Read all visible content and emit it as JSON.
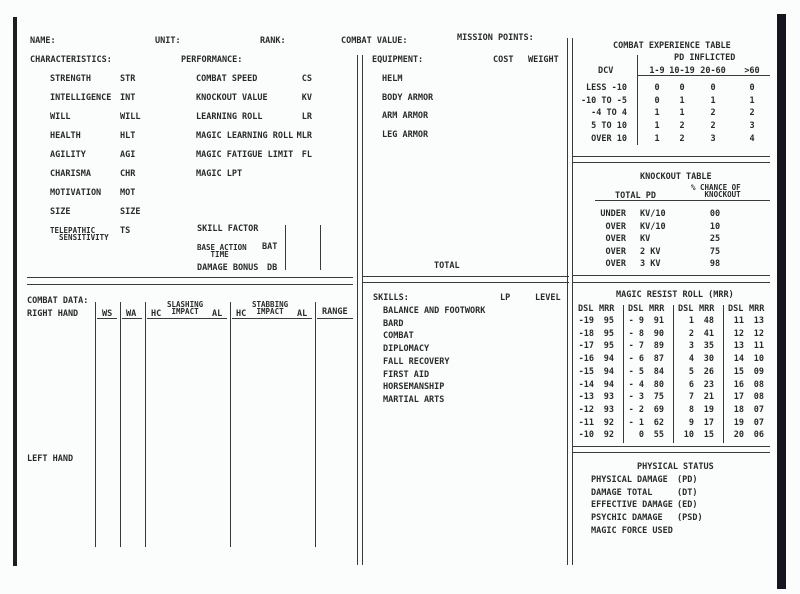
{
  "header": {
    "name_label": "NAME:",
    "unit_label": "UNIT:",
    "rank_label": "RANK:",
    "combat_value_label": "COMBAT VALUE:",
    "mission_points_label": "MISSION POINTS:"
  },
  "characteristics": {
    "title": "CHARACTERISTICS:",
    "items": [
      {
        "label": "STRENGTH",
        "abbr": "STR"
      },
      {
        "label": "INTELLIGENCE",
        "abbr": "INT"
      },
      {
        "label": "WILL",
        "abbr": "WILL"
      },
      {
        "label": "HEALTH",
        "abbr": "HLT"
      },
      {
        "label": "AGILITY",
        "abbr": "AGI"
      },
      {
        "label": "CHARISMA",
        "abbr": "CHR"
      },
      {
        "label": "MOTIVATION",
        "abbr": "MOT"
      },
      {
        "label": "SIZE",
        "abbr": "SIZE"
      },
      {
        "label": "TELEPATHIC",
        "label2": "SENSITIVITY",
        "abbr": "TS"
      }
    ]
  },
  "performance": {
    "title": "PERFORMANCE:",
    "items": [
      {
        "label": "COMBAT SPEED",
        "abbr": "CS"
      },
      {
        "label": "KNOCKOUT VALUE",
        "abbr": "KV"
      },
      {
        "label": "LEARNING ROLL",
        "abbr": "LR"
      },
      {
        "label": "MAGIC LEARNING ROLL",
        "abbr": "MLR"
      },
      {
        "label": "MAGIC FATIGUE LIMIT",
        "abbr": "FL"
      },
      {
        "label": "MAGIC LPT",
        "abbr": ""
      }
    ],
    "skill_factor": "SKILL FACTOR",
    "bat_label": "BASE ACTION",
    "bat_label2": "TIME",
    "bat_abbr": "BAT",
    "db_label": "DAMAGE BONUS",
    "db_abbr": "DB"
  },
  "equipment": {
    "title": "EQUIPMENT:",
    "cost_label": "COST",
    "weight_label": "WEIGHT",
    "items": [
      "HELM",
      "BODY ARMOR",
      "ARM ARMOR",
      "LEG ARMOR"
    ],
    "total_label": "TOTAL"
  },
  "combat_experience": {
    "title": "COMBAT EXPERIENCE TABLE",
    "pd_header": "PD INFLICTED",
    "dcv_header": "DCV",
    "columns": [
      "1-9",
      "10-19",
      "20-60",
      ">60"
    ],
    "rows": [
      {
        "dcv": "LESS -10",
        "values": [
          "0",
          "0",
          "0",
          "0"
        ]
      },
      {
        "dcv": "-10 TO -5",
        "values": [
          "0",
          "1",
          "1",
          "1"
        ]
      },
      {
        "dcv": "-4 TO  4",
        "values": [
          "1",
          "1",
          "2",
          "2"
        ]
      },
      {
        "dcv": "5 TO 10",
        "values": [
          "1",
          "2",
          "2",
          "3"
        ]
      },
      {
        "dcv": "OVER  10",
        "values": [
          "1",
          "2",
          "3",
          "4"
        ]
      }
    ]
  },
  "knockout_table": {
    "title": "KNOCKOUT TABLE",
    "pd_header": "TOTAL PD",
    "chance_header1": "%  CHANCE OF",
    "chance_header2": "KNOCKOUT",
    "rows": [
      {
        "cond": "UNDER",
        "pd": "KV/10",
        "chance": "00"
      },
      {
        "cond": "OVER",
        "pd": "KV/10",
        "chance": "10"
      },
      {
        "cond": "OVER",
        "pd": "KV",
        "chance": "25"
      },
      {
        "cond": "OVER",
        "pd": "2  KV",
        "chance": "75"
      },
      {
        "cond": "OVER",
        "pd": "3  KV",
        "chance": "98"
      }
    ]
  },
  "combat_data": {
    "title": "COMBAT DATA:",
    "right_hand": "RIGHT HAND",
    "left_hand": "LEFT HAND",
    "ws": "WS",
    "wa": "WA",
    "slashing": "SLASHING",
    "stabbing": "STABBING",
    "hc": "HC",
    "impact": "IMPACT",
    "al": "AL",
    "range": "RANGE"
  },
  "skills": {
    "title": "SKILLS:",
    "lp_label": "LP",
    "level_label": "LEVEL",
    "items": [
      "BALANCE AND FOOTWORK",
      "BARD",
      "COMBAT",
      "DIPLOMACY",
      "FALL RECOVERY",
      "FIRST AID",
      "HORSEMANSHIP",
      "MARTIAL ARTS"
    ]
  },
  "magic_resist": {
    "title": "MAGIC RESIST ROLL  (MRR)",
    "dsl": "DSL",
    "mrr": "MRR",
    "groups": [
      [
        [
          "-19",
          "95"
        ],
        [
          "-18",
          "95"
        ],
        [
          "-17",
          "95"
        ],
        [
          "-16",
          "94"
        ],
        [
          "-15",
          "94"
        ],
        [
          "-14",
          "94"
        ],
        [
          "-13",
          "93"
        ],
        [
          "-12",
          "93"
        ],
        [
          "-11",
          "92"
        ],
        [
          "-10",
          "92"
        ]
      ],
      [
        [
          "- 9",
          "91"
        ],
        [
          "- 8",
          "90"
        ],
        [
          "- 7",
          "89"
        ],
        [
          "- 6",
          "87"
        ],
        [
          "- 5",
          "84"
        ],
        [
          "- 4",
          "80"
        ],
        [
          "- 3",
          "75"
        ],
        [
          "- 2",
          "69"
        ],
        [
          "- 1",
          "62"
        ],
        [
          "0",
          "55"
        ]
      ],
      [
        [
          "1",
          "48"
        ],
        [
          "2",
          "41"
        ],
        [
          "3",
          "35"
        ],
        [
          "4",
          "30"
        ],
        [
          "5",
          "26"
        ],
        [
          "6",
          "23"
        ],
        [
          "7",
          "21"
        ],
        [
          "8",
          "19"
        ],
        [
          "9",
          "17"
        ],
        [
          "10",
          "15"
        ]
      ],
      [
        [
          "11",
          "13"
        ],
        [
          "12",
          "12"
        ],
        [
          "13",
          "11"
        ],
        [
          "14",
          "10"
        ],
        [
          "15",
          "09"
        ],
        [
          "16",
          "08"
        ],
        [
          "17",
          "08"
        ],
        [
          "18",
          "07"
        ],
        [
          "19",
          "07"
        ],
        [
          "20",
          "06"
        ]
      ]
    ]
  },
  "physical_status": {
    "title": "PHYSICAL STATUS",
    "items": [
      {
        "label": "PHYSICAL DAMAGE",
        "abbr": "(PD)"
      },
      {
        "label": "DAMAGE TOTAL",
        "abbr": "(DT)"
      },
      {
        "label": "EFFECTIVE DAMAGE",
        "abbr": "(ED)"
      },
      {
        "label": "PSYCHIC DAMAGE",
        "abbr": "(PSD)"
      },
      {
        "label": "MAGIC FORCE USED",
        "abbr": ""
      }
    ]
  }
}
